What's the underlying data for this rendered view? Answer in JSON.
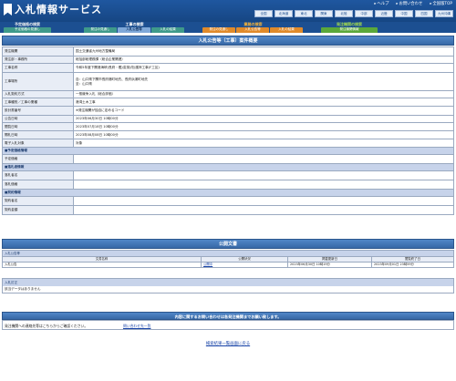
{
  "header": {
    "title": "入札情報サービス",
    "links": [
      "ヘルプ",
      "お問い合わせ",
      "全国版TOP"
    ],
    "regions": [
      "全国",
      "北海道",
      "東北",
      "関東",
      "北陸",
      "中部",
      "近畿",
      "中国",
      "四国",
      "九州沖縄"
    ]
  },
  "nav": {
    "groups": [
      {
        "title": "予定価格の検索",
        "color": "#f0f0f0",
        "tabs": [
          "予定価格の見通し"
        ],
        "tab_colors": [
          "#3f9a8a"
        ]
      },
      {
        "title": "工事の検索",
        "color": "#ffffff",
        "tabs": [
          "発注の見通し",
          "入札公告等",
          "入札の結果"
        ],
        "tab_colors": [
          "#3f9a8a",
          "#7fa8d8",
          "#3f9a8a"
        ]
      },
      {
        "title": "業務の検索",
        "color": "#f3b23a",
        "tabs": [
          "発注の見通し",
          "入札公告等",
          "入札の結果"
        ],
        "tab_colors": [
          "#e08a2a",
          "#e08a2a",
          "#e08a2a"
        ]
      },
      {
        "title": "発注機関の検索",
        "color": "#9fd84f",
        "tabs": [
          "発注機関情報"
        ],
        "tab_colors": [
          "#5ba83a"
        ]
      }
    ]
  },
  "case": {
    "section_title": "入札公告等（工事）案件概要",
    "rows": [
      {
        "label": "発注機関",
        "value": "国土交通省九州地方整備局"
      },
      {
        "label": "発注部・事務所",
        "value": "総括部総理務課（総合企業関連）"
      },
      {
        "label": "工事名称",
        "value": "令和5年度下関港海峡(長府・鑑)浚渫(改)護岸工事(F工区)"
      },
      {
        "label": "工事場所",
        "value": "自：山口県下関市長府港町地先、長府浜浦町地先\n至：山口県"
      },
      {
        "label": "入札契約方式",
        "value": "一般競争入札（総合評価）"
      },
      {
        "label": "工事種別／工事の業種",
        "value": "港湾土木工事"
      },
      {
        "label": "設計書番号",
        "value": "※発注機関が独自に定めるコード"
      },
      {
        "label": "公告日時",
        "value": "2023年06月30日 10時00分"
      },
      {
        "label": "閲覧日時",
        "value": "2023年07月18日 10時00分"
      },
      {
        "label": "開札日時",
        "value": "2023年08月08日 10時00分"
      },
      {
        "label": "電子入札対象",
        "value": "対象"
      }
    ],
    "estimate_header": "■予定価格情報",
    "estimate_rows": [
      {
        "label": "予定価格",
        "value": ""
      }
    ],
    "winner_header": "■落札者情報",
    "winner_rows": [
      {
        "label": "落札者名",
        "value": ""
      },
      {
        "label": "落札価格",
        "value": ""
      }
    ],
    "contract_header": "■契約情報",
    "contract_rows": [
      {
        "label": "契約者名",
        "value": ""
      },
      {
        "label": "契約金額",
        "value": ""
      }
    ]
  },
  "docs": {
    "section_title": "公開文書",
    "group_label": "入札公告等",
    "columns": [
      "文書名称",
      "公開状況",
      "掲載更新日",
      "閲覧終了日"
    ],
    "rows": [
      {
        "name": "入札公告",
        "status": "公開中",
        "updated": "2023年06月30日 10時19分",
        "end": "2023年09月01日 23時59分"
      }
    ]
  },
  "change": {
    "header": "入札訂正",
    "body": "該当データはありません"
  },
  "contact": {
    "section_title": "内容に関するお問い合わせは各発注機関までお願い致します。",
    "text": "発注機関への連絡先等はこちらからご確認ください。",
    "link": "問い合わせ先一覧"
  },
  "footer": {
    "back_link": "検索結果一覧画面に戻る"
  }
}
